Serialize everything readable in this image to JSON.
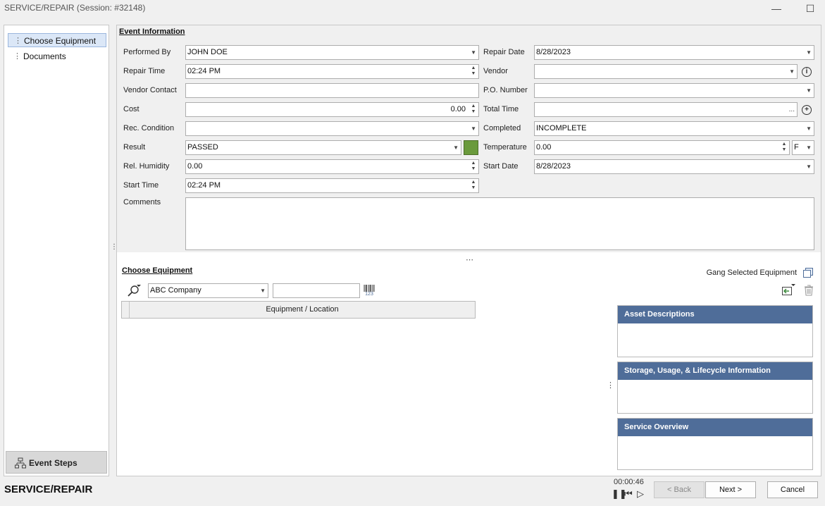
{
  "window": {
    "title": "SERVICE/REPAIR (Session: #32148)"
  },
  "nav": {
    "items": [
      {
        "label": "Choose Equipment"
      },
      {
        "label": "Documents"
      }
    ],
    "event_steps_label": "Event Steps"
  },
  "event_info": {
    "title": "Event Information",
    "performed_by": {
      "label": "Performed By",
      "value": "JOHN DOE"
    },
    "repair_date": {
      "label": "Repair Date",
      "value": "8/28/2023"
    },
    "repair_time": {
      "label": "Repair Time",
      "value": "02:24 PM"
    },
    "vendor": {
      "label": "Vendor",
      "value": ""
    },
    "vendor_contact": {
      "label": "Vendor Contact",
      "value": ""
    },
    "po_number": {
      "label": "P.O. Number",
      "value": ""
    },
    "cost": {
      "label": "Cost",
      "value": "0.00"
    },
    "total_time": {
      "label": "Total Time",
      "value": "",
      "ellipsis": "..."
    },
    "rec_condition": {
      "label": "Rec. Condition",
      "value": ""
    },
    "completed": {
      "label": "Completed",
      "value": "INCOMPLETE"
    },
    "result": {
      "label": "Result",
      "value": "PASSED",
      "color": "#6a9a3c"
    },
    "temperature": {
      "label": "Temperature",
      "value": "0.00",
      "unit": "F"
    },
    "rel_humidity": {
      "label": "Rel. Humidity",
      "value": "0.00"
    },
    "start_date": {
      "label": "Start Date",
      "value": "8/28/2023"
    },
    "start_time": {
      "label": "Start Time",
      "value": "02:24 PM"
    },
    "comments": {
      "label": "Comments",
      "value": ""
    }
  },
  "choose_equipment": {
    "title": "Choose Equipment",
    "gang_label": "Gang Selected Equipment",
    "company": "ABC Company",
    "barcode_input": "",
    "barcode_digits": "123",
    "table_header": "Equipment / Location"
  },
  "panels": [
    {
      "title": "Asset Descriptions"
    },
    {
      "title": "Storage, Usage, & Lifecycle Information"
    },
    {
      "title": "Service Overview"
    }
  ],
  "footer": {
    "title": "SERVICE/REPAIR",
    "timer": "00:00:46",
    "back_label": "< Back",
    "next_label": "Next >",
    "cancel_label": "Cancel"
  },
  "colors": {
    "panel_header": "#4f6d99",
    "nav_active": "#dbe7f7"
  }
}
